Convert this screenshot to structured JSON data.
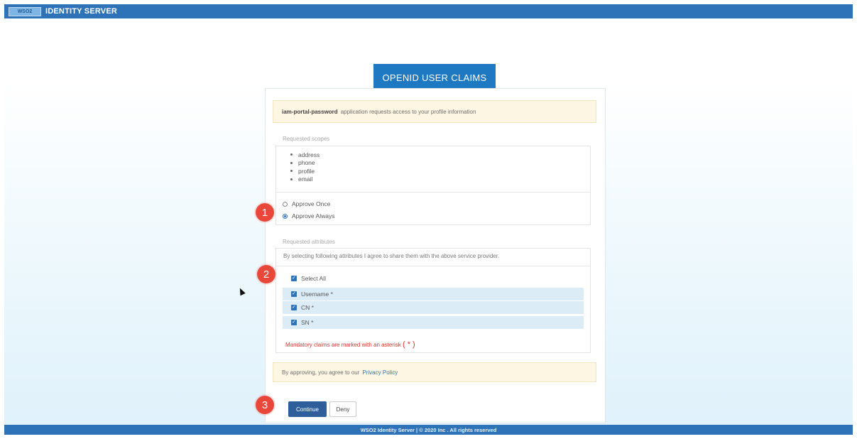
{
  "header": {
    "logo_text": "WSO2",
    "title": "IDENTITY SERVER"
  },
  "page_title": "OPENID USER CLAIMS",
  "consent": {
    "app_name": "iam-portal-password",
    "app_request_text": "application requests access to your profile information",
    "scopes_label": "Requested scopes",
    "scopes": [
      "address",
      "phone",
      "profile",
      "email"
    ],
    "approve_once_label": "Approve Once",
    "approve_always_label": "Approve Always",
    "approve_selected": "always",
    "attributes_label": "Requested attributes",
    "attributes_intro": "By selecting following attributes I agree to share them with the above service provider.",
    "select_all_label": "Select All",
    "attributes": [
      {
        "label": "Username *",
        "checked": true
      },
      {
        "label": "CN *",
        "checked": true
      },
      {
        "label": "SN *",
        "checked": true
      }
    ],
    "mandatory_text": "Mandatory claims are marked with an asterisk",
    "mandatory_marker": "( * )",
    "privacy_text": "By approving, you agree to our",
    "privacy_link": "Privacy Policy"
  },
  "actions": {
    "continue_label": "Continue",
    "deny_label": "Deny"
  },
  "steps": [
    "1",
    "2",
    "3"
  ],
  "footer": {
    "text": "WSO2 Identity Server | © 2020 Inc . All rights reserved"
  },
  "colors": {
    "brand_blue": "#2e73b7",
    "header_tab": "#1e78c2",
    "step_badge": "#e8473a",
    "notice_bg": "#fdf6e3",
    "attribute_highlight": "#dcecf6"
  }
}
